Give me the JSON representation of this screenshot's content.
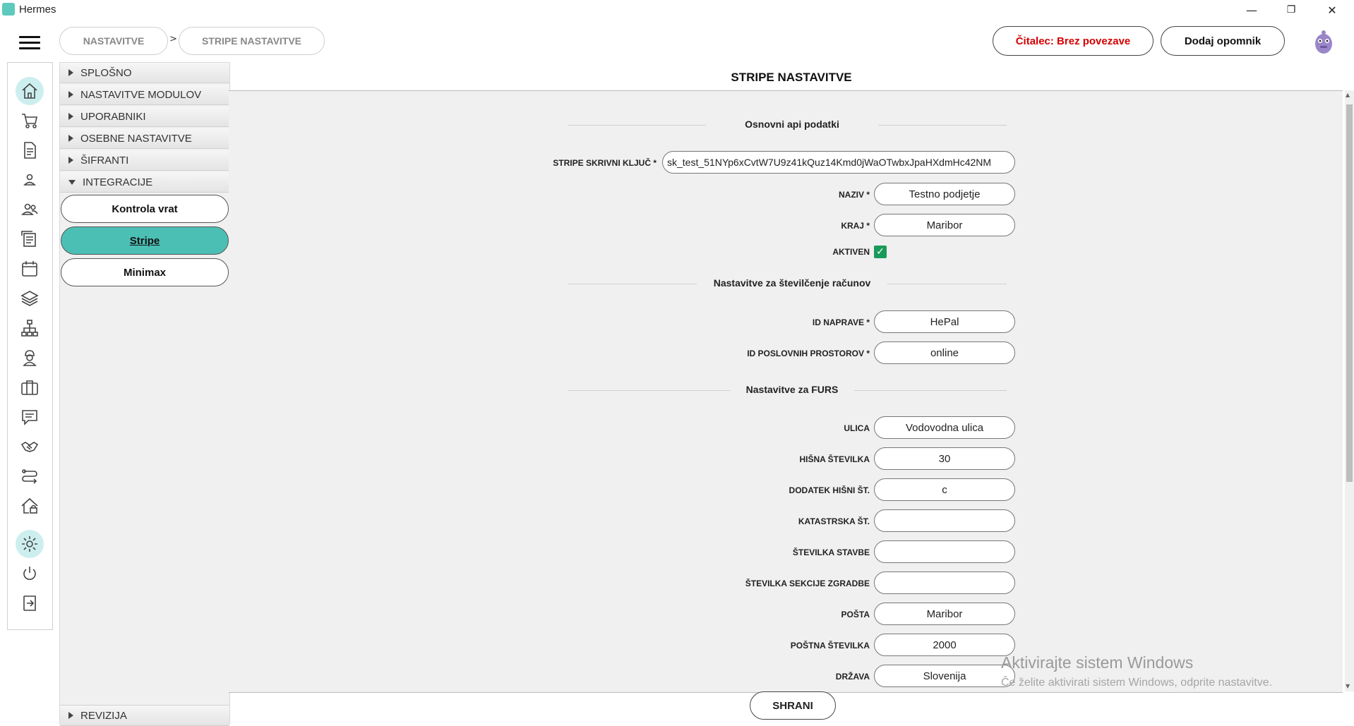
{
  "window": {
    "title": "Hermes",
    "minimize": "—",
    "restore": "❐",
    "close": "✕"
  },
  "breadcrumb": {
    "items": [
      "NASTAVITVE",
      "STRIPE NASTAVITVE"
    ],
    "separator": ">"
  },
  "header": {
    "reader_status": "Čitalec: Brez povezave",
    "add_reminder": "Dodaj opomnik"
  },
  "colors": {
    "accent": "#4cbfb5",
    "danger": "#d40000",
    "check": "#1a9a5a"
  },
  "iconbar": [
    "home-icon",
    "cart-icon",
    "document-icon",
    "user-icon",
    "users-icon",
    "list-icon",
    "calendar-icon",
    "layers-icon",
    "network-icon",
    "worker-icon",
    "briefcase-icon",
    "chat-icon",
    "handshake-icon",
    "route-icon",
    "house-icon",
    "settings-icon",
    "power-icon",
    "logout-icon"
  ],
  "sidebar": {
    "sections": [
      "SPLOŠNO",
      "NASTAVITVE MODULOV",
      "UPORABNIKI",
      "OSEBNE NASTAVITVE",
      "ŠIFRANTI",
      "INTEGRACIJE"
    ],
    "items": [
      "Kontrola vrat",
      "Stripe",
      "Minimax"
    ],
    "active_item": "Stripe",
    "bottom": "REVIZIJA"
  },
  "main": {
    "title": "STRIPE NASTAVITVE",
    "sections": [
      "Osnovni api podatki",
      "Nastavitve za številčenje računov",
      "Nastavitve za FURS"
    ],
    "fields": {
      "secret_key": {
        "label": "STRIPE SKRIVNI KLJUČ *",
        "value": "sk_test_51NYp6xCvtW7U9z41kQuz14Kmd0jWaOTwbxJpaHXdmHc42NM"
      },
      "naziv": {
        "label": "NAZIV *",
        "value": "Testno podjetje"
      },
      "kraj": {
        "label": "KRAJ *",
        "value": "Maribor"
      },
      "aktiven": {
        "label": "AKTIVEN",
        "checked": true,
        "mark": "✓"
      },
      "id_naprave": {
        "label": "ID NAPRAVE *",
        "value": "HePal"
      },
      "id_prostorov": {
        "label": "ID POSLOVNIH PROSTOROV *",
        "value": "online"
      },
      "ulica": {
        "label": "ULICA",
        "value": "Vodovodna ulica"
      },
      "hisna": {
        "label": "HIŠNA ŠTEVILKA",
        "value": "30"
      },
      "dodatek": {
        "label": "DODATEK HIŠNI ŠT.",
        "value": "c"
      },
      "katastrska": {
        "label": "KATASTRSKA ŠT.",
        "value": ""
      },
      "stavbe": {
        "label": "ŠTEVILKA STAVBE",
        "value": ""
      },
      "sekcije": {
        "label": "ŠTEVILKA SEKCIJE ZGRADBE",
        "value": ""
      },
      "posta": {
        "label": "POŠTA",
        "value": "Maribor"
      },
      "postna": {
        "label": "POŠTNA ŠTEVILKA",
        "value": "2000"
      },
      "drzava": {
        "label": "DRŽAVA",
        "value": "Slovenija"
      }
    },
    "save": "SHRANI"
  },
  "watermark": {
    "line1": "Aktivirajte sistem Windows",
    "line2": "Če želite aktivirati sistem Windows, odprite nastavitve."
  }
}
